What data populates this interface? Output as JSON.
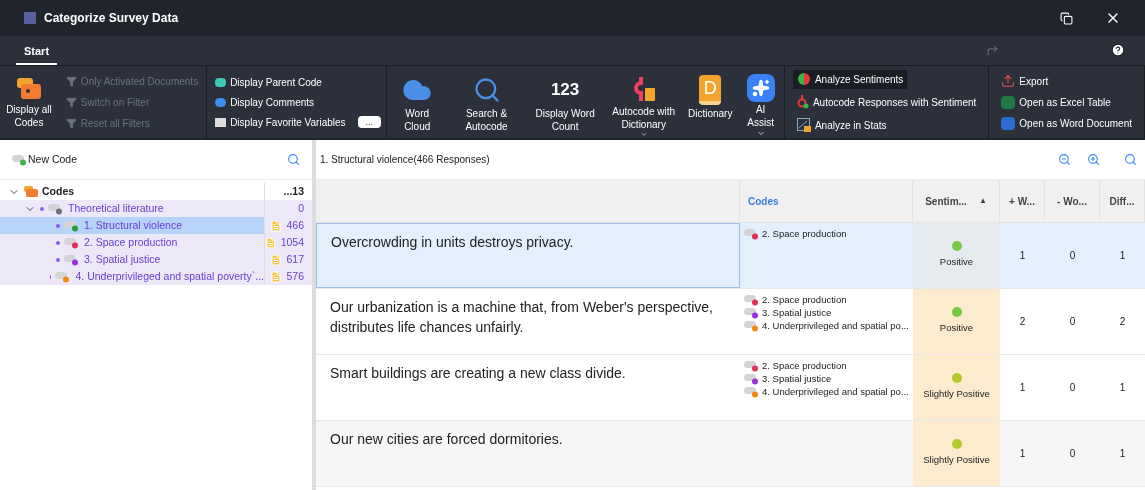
{
  "window": {
    "title": "Categorize Survey Data"
  },
  "tabs": [
    {
      "label": "Start",
      "selected": true
    }
  ],
  "ribbon": {
    "display_all_codes": "Display all Codes",
    "filters": [
      {
        "label": "Only Activated Documents",
        "disabled": true
      },
      {
        "label": "Switch on Filter",
        "disabled": true
      },
      {
        "label": "Reset all Filters",
        "disabled": true
      }
    ],
    "display_options": [
      "Display Parent Code",
      "Display Comments",
      "Display Favorite Variables"
    ],
    "more_button": "...",
    "tools": [
      {
        "kind": "cloud",
        "label": "Word Cloud",
        "dropdown": false
      },
      {
        "kind": "search",
        "label": "Search & Autocode",
        "dropdown": false
      },
      {
        "kind": "count",
        "icon_text": "123",
        "label": "Display Word Count",
        "dropdown": false
      },
      {
        "kind": "autocode",
        "label": "Autocode with Dictionary",
        "dropdown": true
      },
      {
        "kind": "dictionary",
        "icon_text": "D",
        "label": "Dictionary",
        "dropdown": false
      },
      {
        "kind": "ai",
        "label": "AI Assist",
        "dropdown": true
      }
    ],
    "sentiment": [
      {
        "kind": "sentiment",
        "label": "Analyze Sentiments",
        "selected": true
      },
      {
        "kind": "autocode",
        "label": "Autocode Responses with Sentiment",
        "selected": false
      },
      {
        "kind": "stats",
        "label": "Analyze in Stats",
        "selected": false
      }
    ],
    "export": [
      {
        "kind": "export",
        "label": "Export"
      },
      {
        "kind": "excel",
        "label": "Open as Excel Table"
      },
      {
        "kind": "word",
        "label": "Open as Word Document"
      }
    ]
  },
  "code_panel": {
    "new_code": "New Code",
    "tree": [
      {
        "label": "Codes",
        "count": "...13",
        "expanded": true,
        "children": [
          {
            "label": "Theoretical literature",
            "count": "0",
            "color": "#6b7280",
            "expanded": true,
            "selected": false,
            "children": [
              {
                "label": "1. Structural violence",
                "count": "466",
                "color": "#22a33a",
                "selected": true,
                "memo": true
              },
              {
                "label": "2. Space production",
                "count": "1054",
                "color": "#e0305a",
                "selected": false,
                "memo": true
              },
              {
                "label": "3. Spatial justice",
                "count": "617",
                "color": "#9b30e0",
                "selected": false,
                "memo": true
              },
              {
                "label": "4. Underprivileged and spatial poverty`...",
                "count": "576",
                "color": "#f08a10",
                "selected": false,
                "memo": true
              }
            ]
          }
        ]
      }
    ]
  },
  "responses": {
    "heading": "1. Structural violence(466 Responses)",
    "columns": [
      {
        "label": "Codes"
      },
      {
        "label": "Sentim...",
        "sort_mark": "▲"
      },
      {
        "label": "+ W..."
      },
      {
        "label": "- Wo..."
      },
      {
        "label": "Diff..."
      }
    ],
    "rows": [
      {
        "text": "Overcrowding in units destroys privacy.",
        "selected": true,
        "codes": [
          {
            "label": "2. Space production",
            "color": "#e0305a"
          }
        ],
        "sentiment": {
          "label": "Positive",
          "color": "#7ac943"
        },
        "plus": "1",
        "minus": "0",
        "diff": "1"
      },
      {
        "text": "Our urbanization is a machine that, from Weber's perspective, distributes life chances unfairly.",
        "selected": false,
        "codes": [
          {
            "label": "2. Space production",
            "color": "#e0305a"
          },
          {
            "label": "3. Spatial justice",
            "color": "#9b30e0"
          },
          {
            "label": "4. Underprivileged and spatial po...",
            "color": "#f08a10"
          }
        ],
        "sentiment": {
          "label": "Positive",
          "color": "#7ac943"
        },
        "plus": "2",
        "minus": "0",
        "diff": "2"
      },
      {
        "text": "Smart buildings are creating a new class divide.",
        "selected": false,
        "codes": [
          {
            "label": "2. Space production",
            "color": "#e0305a"
          },
          {
            "label": "3. Spatial justice",
            "color": "#9b30e0"
          },
          {
            "label": "4. Underprivileged and spatial po...",
            "color": "#f08a10"
          }
        ],
        "sentiment": {
          "label": "Slightly Positive",
          "color": "#b5c92a"
        },
        "plus": "1",
        "minus": "0",
        "diff": "1"
      },
      {
        "text": "Our new cities are forced dormitories.",
        "selected": false,
        "codes": [],
        "sentiment": {
          "label": "Slightly Positive",
          "color": "#b5c92a"
        },
        "plus": "1",
        "minus": "0",
        "diff": "1"
      }
    ]
  }
}
